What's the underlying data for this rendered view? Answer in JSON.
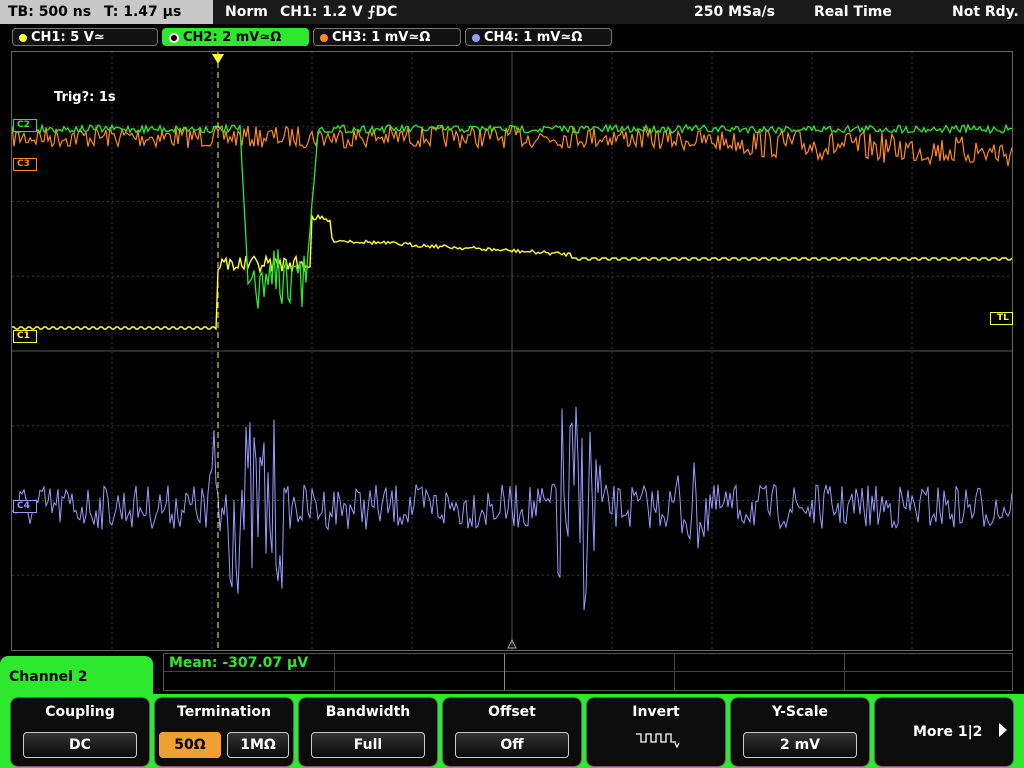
{
  "topbar": {
    "timebase": "TB: 500 ns",
    "trigger_time": "T: 1.47 µs",
    "mode": "Norm",
    "trigger_info": "CH1: 1.2 V ⨍DC",
    "sample_rate": "250 MSa/s",
    "acq_mode": "Real Time",
    "status": "Not Rdy."
  },
  "channels": [
    {
      "label": "CH1: 5 V≃",
      "color": "#ffff33"
    },
    {
      "label": "CH2: 2 mV≃Ω",
      "color": "#2ee82e"
    },
    {
      "label": "CH3: 1 mV≃Ω",
      "color": "#ff8c1a"
    },
    {
      "label": "CH4: 1 mV≃Ω",
      "color": "#9b9bff"
    }
  ],
  "screen": {
    "trig_text": "Trig?: 1s",
    "markers": {
      "c1": "C1",
      "c2": "C2",
      "c3": "C3",
      "c4": "C4",
      "tl": "TL"
    }
  },
  "measurement": "Mean: -307.07 µV",
  "menu": {
    "title": "Channel 2",
    "coupling_label": "Coupling",
    "coupling_value": "DC",
    "termination_label": "Termination",
    "term_50": "50Ω",
    "term_1m": "1MΩ",
    "bandwidth_label": "Bandwidth",
    "bandwidth_value": "Full",
    "offset_label": "Offset",
    "offset_value": "Off",
    "invert_label": "Invert",
    "yscale_label": "Y-Scale",
    "yscale_value": "2 mV",
    "more_label": "More 1|2"
  }
}
